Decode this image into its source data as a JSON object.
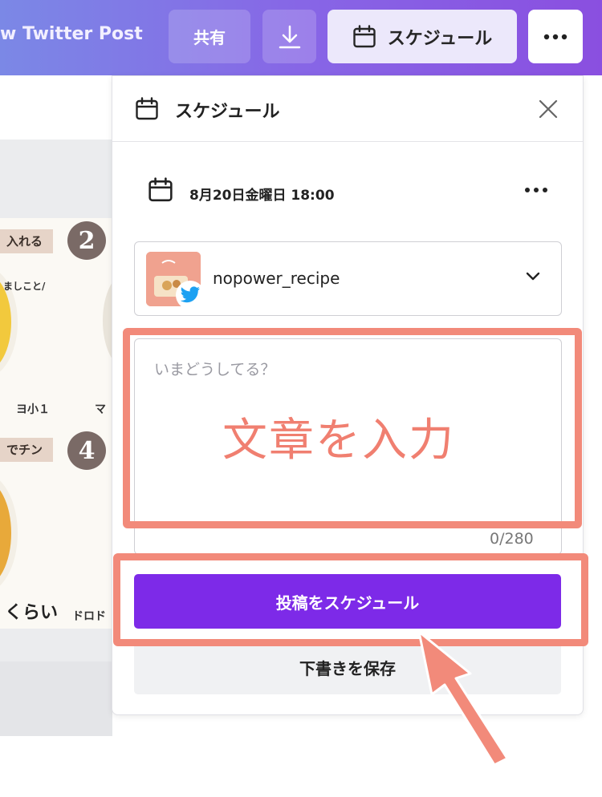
{
  "topbar": {
    "doc_title": "w Twitter Post",
    "share_label": "共有",
    "download_icon": "download-icon",
    "schedule_label": "スケジュール",
    "schedule_icon": "calendar-icon",
    "more_icon": "more-horizontal-icon"
  },
  "canvas": {
    "step2_tag": "入れる",
    "step2_number": "2",
    "step2_note": "ヨ小１",
    "step2_note_right": "マ",
    "step4_tag": "でチン",
    "step4_number": "4",
    "step4_note": "くらい",
    "step4_note_right": "ドロド"
  },
  "panel": {
    "title": "スケジュール",
    "date_label": "8月20日金曜日 18:00",
    "account_name": "nopower_recipe",
    "placeholder": "いまどうしてる？",
    "char_count": "0/280",
    "schedule_post_label": "投稿をスケジュール",
    "save_draft_label": "下書きを保存"
  },
  "annotation": {
    "text": "文章を入力",
    "color": "#f28a7a"
  },
  "colors": {
    "accent": "#7d2ae8",
    "twitter": "#1da1f2"
  }
}
